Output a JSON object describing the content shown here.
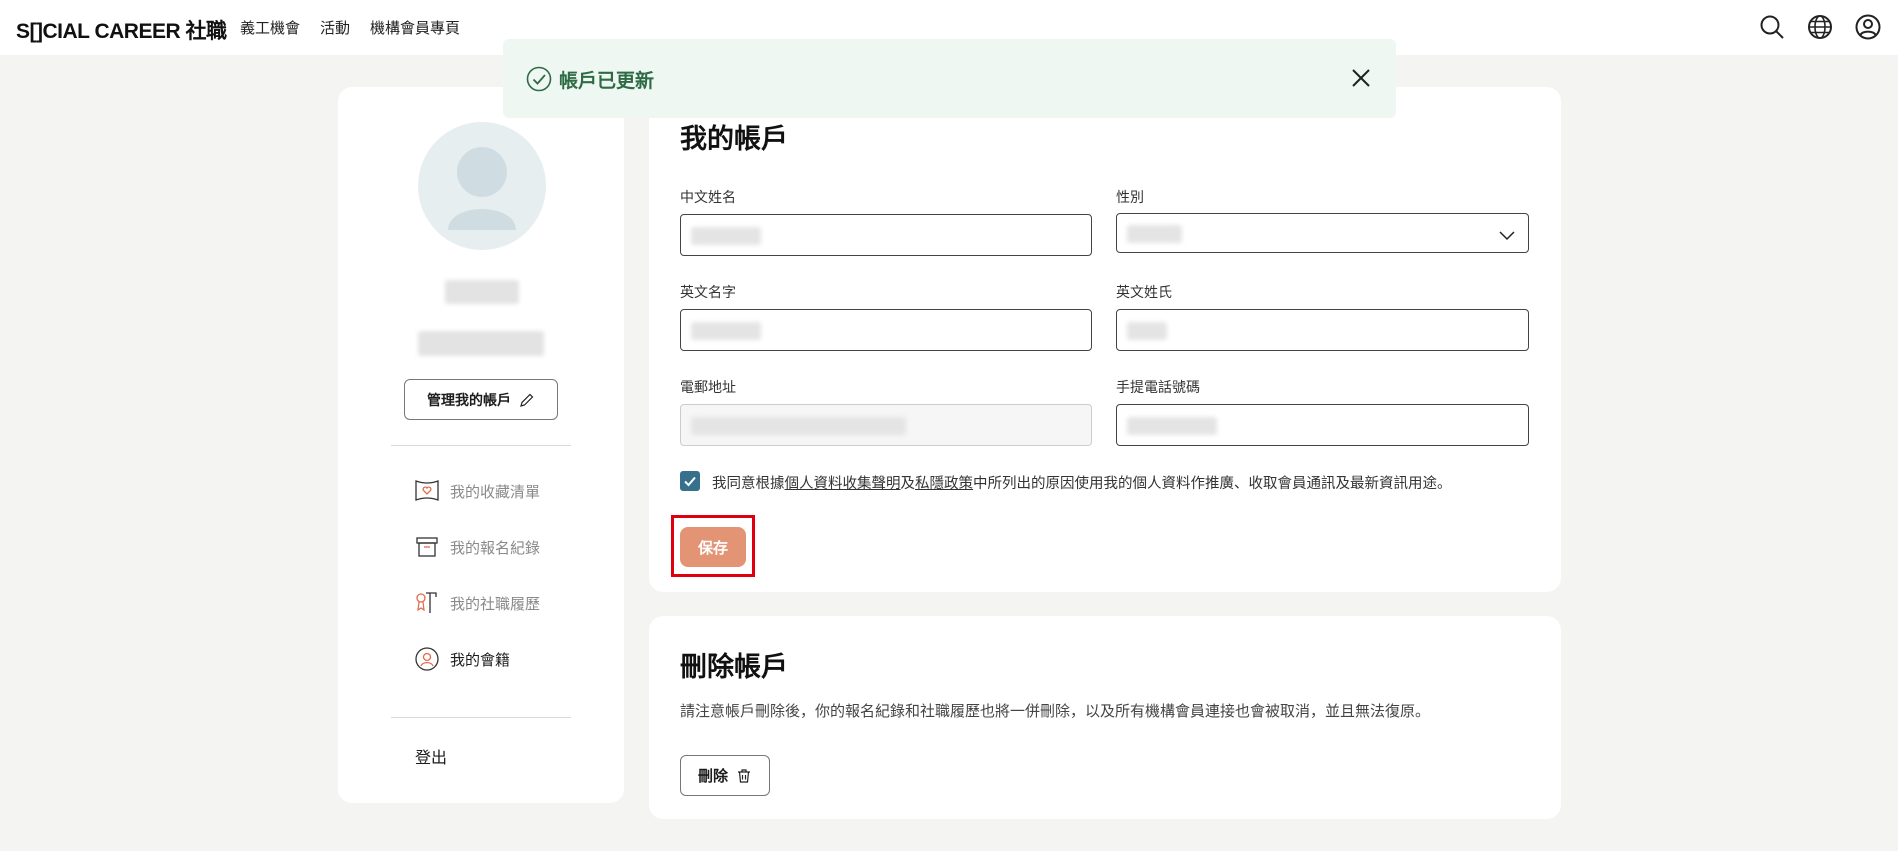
{
  "nav": {
    "logo": "S[]CIAL CAREER 社職",
    "links": [
      "義工機會",
      "活動",
      "機構會員專頁"
    ],
    "icons": [
      "search-icon",
      "globe-icon",
      "user-icon"
    ]
  },
  "toast": {
    "message": "帳戶已更新"
  },
  "sidebar": {
    "manage_label": "管理我的帳戶",
    "items": [
      {
        "label": "我的收藏清單",
        "icon": "bookmark-heart-icon"
      },
      {
        "label": "我的報名紀錄",
        "icon": "archive-box-icon"
      },
      {
        "label": "我的社職履歷",
        "icon": "certificate-icon"
      },
      {
        "label": "我的會籍",
        "icon": "membership-icon"
      }
    ],
    "logout_label": "登出"
  },
  "account": {
    "title": "我的帳戶",
    "fields": {
      "chinese_name": {
        "label": "中文姓名"
      },
      "gender": {
        "label": "性別"
      },
      "english_first": {
        "label": "英文名字"
      },
      "english_last": {
        "label": "英文姓氏"
      },
      "email": {
        "label": "電郵地址"
      },
      "mobile": {
        "label": "手提電話號碼"
      }
    },
    "consent": {
      "checked": true,
      "prefix": "我同意根據",
      "link1": "個人資料收集聲明",
      "mid": "及",
      "link2": "私隱政策",
      "suffix": "中所列出的原因使用我的個人資料作推廣、收取會員通訊及最新資訊用途。"
    },
    "save_label": "保存"
  },
  "delete": {
    "title": "刪除帳戶",
    "text": "請注意帳戶刪除後，你的報名紀錄和社職履歷也將一併刪除，以及所有機構會員連接也會被取消，並且無法復原。",
    "button_label": "刪除"
  },
  "colors": {
    "accent_save": "#e39474",
    "checkbox": "#36708c",
    "toast_bg": "#eef7f1",
    "toast_text": "#2e6b45",
    "highlight": "#e0000d"
  }
}
